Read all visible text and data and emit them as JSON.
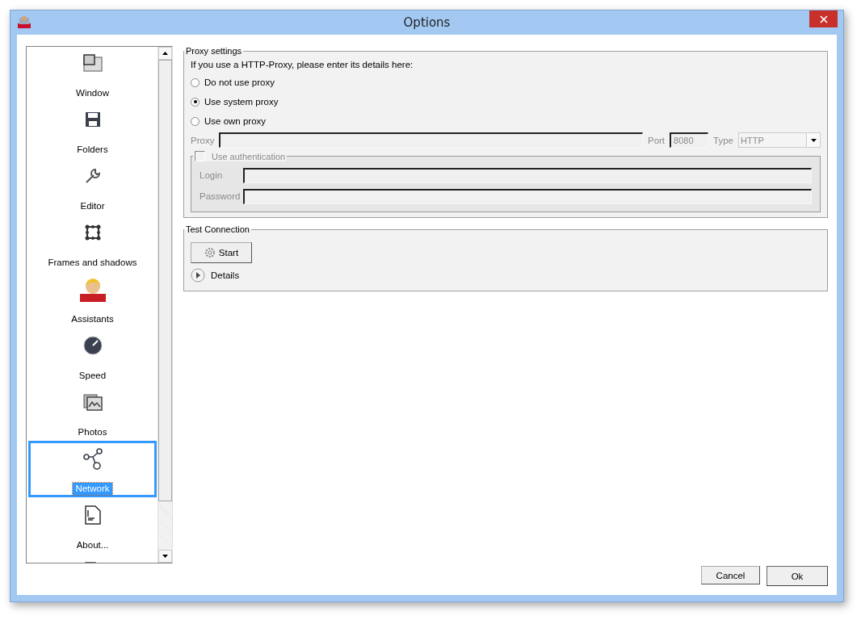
{
  "window": {
    "title": "Options"
  },
  "sidebar": {
    "items": [
      {
        "kind": "window",
        "label": "Window",
        "selected": false
      },
      {
        "kind": "save",
        "label": "Folders",
        "selected": false
      },
      {
        "kind": "wrench",
        "label": "Editor",
        "selected": false
      },
      {
        "kind": "frame",
        "label": "Frames and shadows",
        "selected": false
      },
      {
        "kind": "avatar",
        "label": "Assistants",
        "selected": false
      },
      {
        "kind": "gauge",
        "label": "Speed",
        "selected": false
      },
      {
        "kind": "photos",
        "label": "Photos",
        "selected": false
      },
      {
        "kind": "network",
        "label": "Network",
        "selected": true
      },
      {
        "kind": "document",
        "label": "About...",
        "selected": false
      },
      {
        "kind": "document",
        "selected": false
      }
    ]
  },
  "proxy_settings": {
    "title": "Proxy settings",
    "intro": "If you use a HTTP-Proxy, please enter its details here:",
    "options": [
      {
        "label": "Do not use proxy",
        "selected": false
      },
      {
        "label": "Use system proxy",
        "selected": true
      },
      {
        "label": "Use own proxy",
        "selected": false
      }
    ],
    "disabled": true,
    "proxy_label": "Proxy",
    "port_label": "Port",
    "port": "8080",
    "type_label": "Type",
    "type": "HTTP",
    "authentication": {
      "label": "Use authentication",
      "checked": false,
      "login_label": "Login",
      "password_label": "Password"
    }
  },
  "test_connection": {
    "title": "Test Connection",
    "start_button": "Start",
    "details": "Details"
  },
  "buttons": {
    "cancel": "Cancel",
    "ok": "Ok"
  }
}
